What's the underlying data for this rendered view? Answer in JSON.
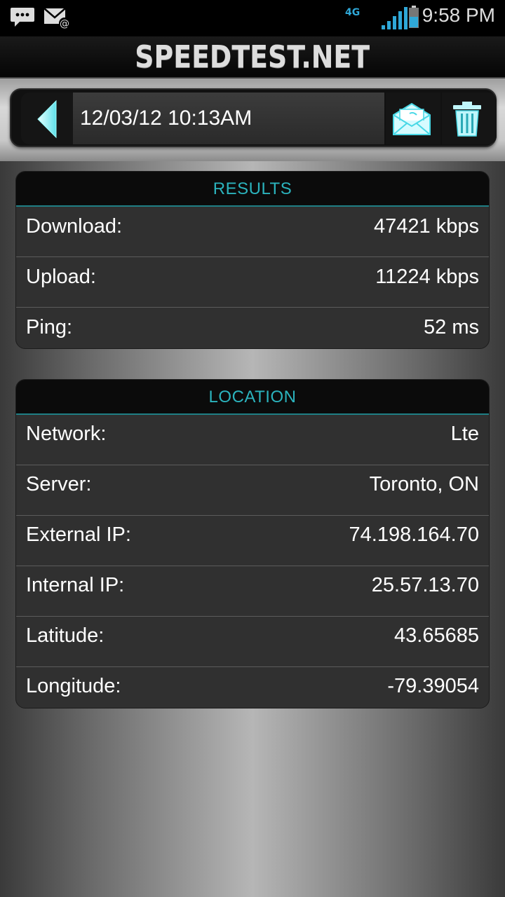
{
  "status_bar": {
    "network_type": "4G",
    "time": "9:58 PM"
  },
  "app": {
    "title": "SPEEDTEST.NET"
  },
  "toolbar": {
    "date": "12/03/12 10:13AM"
  },
  "results": {
    "header": "RESULTS",
    "rows": [
      {
        "label": "Download:",
        "value": "47421 kbps"
      },
      {
        "label": "Upload:",
        "value": "11224 kbps"
      },
      {
        "label": "Ping:",
        "value": "52 ms"
      }
    ]
  },
  "location": {
    "header": "LOCATION",
    "rows": [
      {
        "label": "Network:",
        "value": "Lte"
      },
      {
        "label": "Server:",
        "value": "Toronto, ON"
      },
      {
        "label": "External IP:",
        "value": "74.198.164.70"
      },
      {
        "label": "Internal IP:",
        "value": "25.57.13.70"
      },
      {
        "label": "Latitude:",
        "value": "43.65685"
      },
      {
        "label": "Longitude:",
        "value": "-79.39054"
      }
    ]
  },
  "colors": {
    "accent": "#2bb3bd",
    "panel_bg": "#303030",
    "header_bg": "#0b0b0b"
  },
  "icons": [
    "chat-notification-icon",
    "email-notification-icon",
    "signal-icon",
    "battery-icon",
    "back-arrow-icon",
    "share-email-icon",
    "trash-icon"
  ]
}
